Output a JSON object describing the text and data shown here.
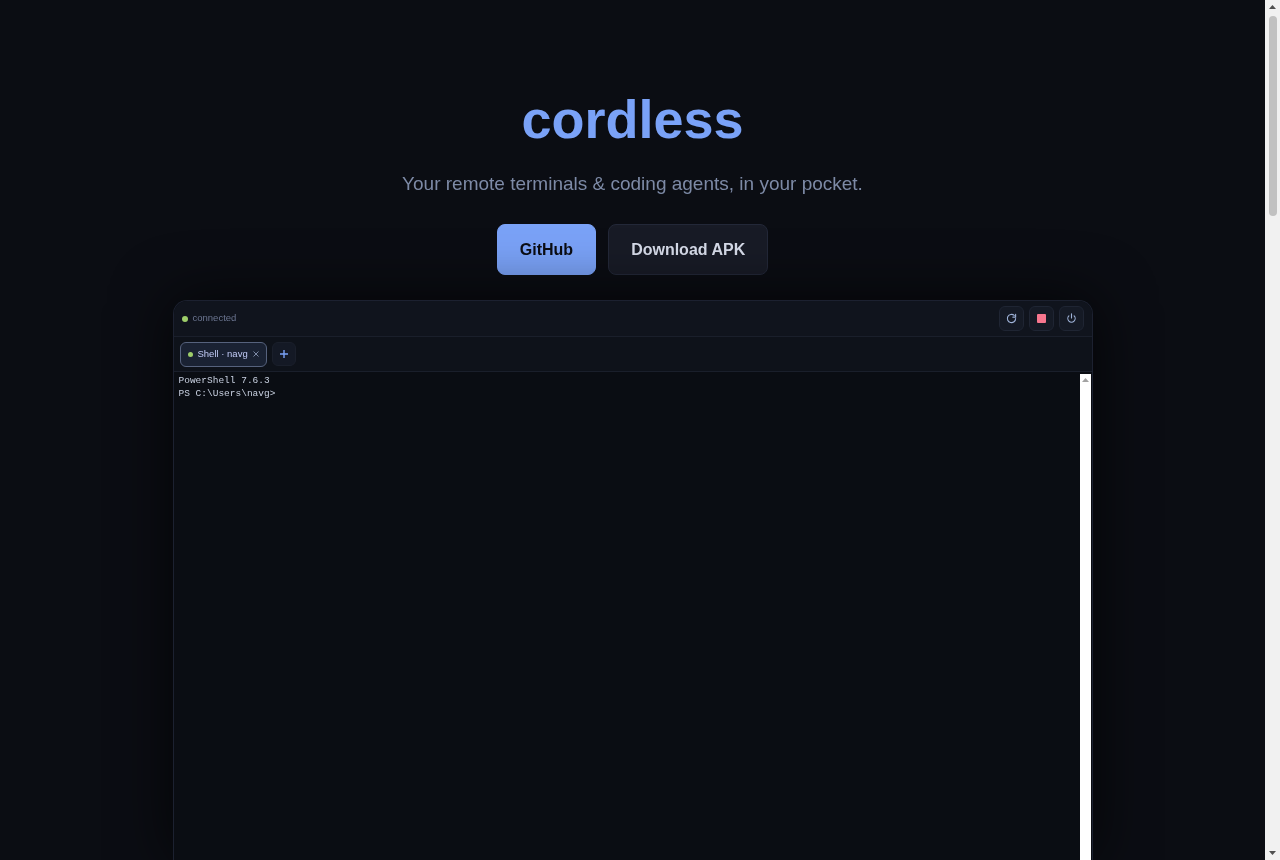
{
  "hero": {
    "title": "cordless",
    "tagline": "Your remote terminals & coding agents, in your pocket.",
    "buttons": [
      {
        "label": "GitHub",
        "kind": "primary"
      },
      {
        "label": "Download APK",
        "kind": "secondary"
      }
    ]
  },
  "terminal": {
    "status": {
      "label": "connected",
      "connected": true
    },
    "tabs": [
      {
        "label": "Shell · navg",
        "selected": true,
        "running": true
      }
    ],
    "output_lines": [
      "PowerShell 7.6.3",
      "PS C:\\Users\\navg>"
    ]
  }
}
